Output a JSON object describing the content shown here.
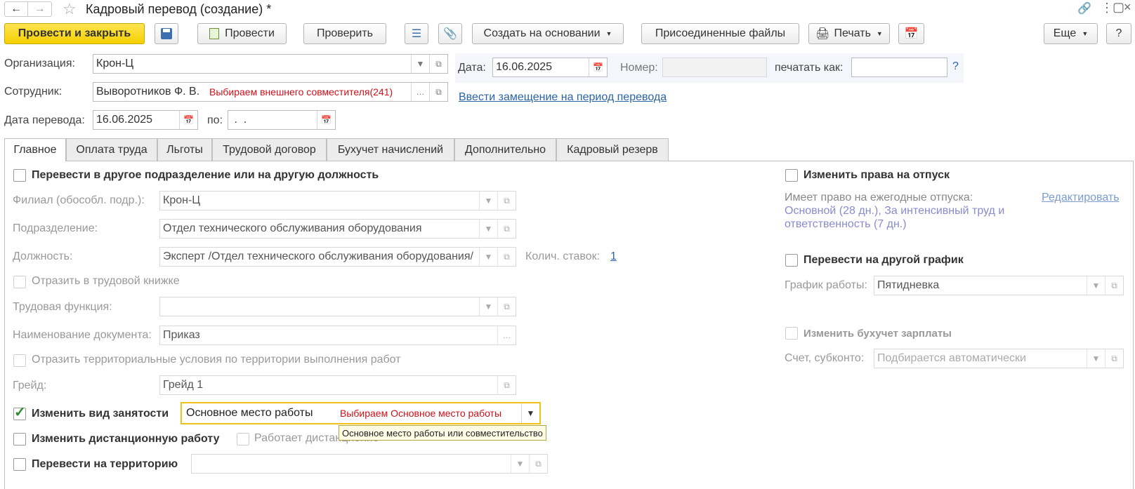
{
  "window": {
    "title": "Кадровый перевод (создание) *"
  },
  "toolbar": {
    "post_close": "Провести и закрыть",
    "post": "Провести",
    "check": "Проверить",
    "create_based": "Создать на основании",
    "attached_files": "Присоединенные файлы",
    "print": "Печать",
    "more": "Еще",
    "help": "?"
  },
  "header": {
    "org_label": "Организация:",
    "org_value": "Крон-Ц",
    "employee_label": "Сотрудник:",
    "employee_value": "Выворотников Ф. В.",
    "employee_note": "Выбираем внешнего совместителя(241)",
    "date_label": "Дата:",
    "date_value": "16.06.2025",
    "number_label": "Номер:",
    "number_value": "",
    "print_as_label": "печатать как:",
    "print_as_value": "",
    "substitution_link": "Ввести замещение на период перевода",
    "transfer_date_label": "Дата перевода:",
    "transfer_date_value": "16.06.2025",
    "to_label": "по:",
    "to_value": " .  ."
  },
  "tabs": [
    "Главное",
    "Оплата труда",
    "Льготы",
    "Трудовой договор",
    "Бухучет начислений",
    "Дополнительно",
    "Кадровый резерв"
  ],
  "main": {
    "transfer_dept_label": "Перевести в другое подразделение или на другую должность",
    "branch_label": "Филиал (обособл. подр.):",
    "branch_value": "Крон-Ц",
    "dept_label": "Подразделение:",
    "dept_value": "Отдел технического обслуживания оборудования",
    "position_label": "Должность:",
    "position_value": "Эксперт /Отдел технического обслуживания оборудования/",
    "rates_label": "Колич. ставок:",
    "rates_value": "1",
    "workbook_label": "Отразить в трудовой книжке",
    "labor_function_label": "Трудовая функция:",
    "labor_function_value": "",
    "doc_name_label": "Наименование документа:",
    "doc_name_value": "Приказ",
    "territorial_label": "Отразить территориальные условия по территории выполнения работ",
    "grade_label": "Грейд:",
    "grade_value": "Грейд 1",
    "employment_type_label": "Изменить вид занятости",
    "employment_type_value": "Основное место работы",
    "employment_note": "Выбираем Основное место работы",
    "employment_tooltip": "Основное место работы или совместительство",
    "remote_label": "Изменить дистанционную работу",
    "works_remote_label": "Работает дистанционно",
    "territory_label": "Перевести на территорию",
    "territory_value": ""
  },
  "right": {
    "vacation_label": "Изменить права на отпуск",
    "vacation_info": "Имеет право на ежегодные отпуска:",
    "edit_link": "Редактировать",
    "vacation_line1": "Основной (28 дн.), За интенсивный труд и",
    "vacation_line2": "ответственность (7 дн.)",
    "schedule_label": "Перевести на другой график",
    "work_schedule_label": "График работы:",
    "work_schedule_value": "Пятидневка",
    "accounting_label": "Изменить бухучет зарплаты",
    "account_label": "Счет, субконто:",
    "account_placeholder": "Подбирается автоматически"
  },
  "colors": {
    "primary": "#f5cf00",
    "link": "#2a64a8",
    "note": "#d0101a",
    "check": "#2e8b2e"
  }
}
